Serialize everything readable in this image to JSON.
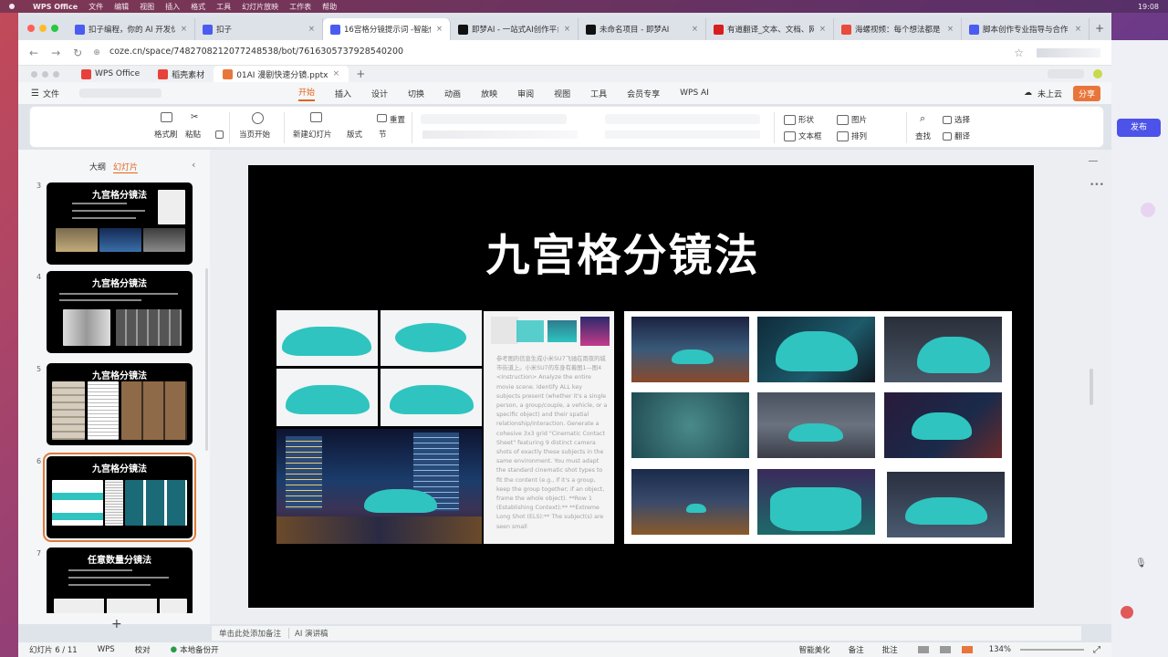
{
  "mac": {
    "app": "WPS Office",
    "menu": [
      "文件",
      "编辑",
      "视图",
      "插入",
      "格式",
      "工具",
      "幻灯片放映",
      "工作表",
      "帮助"
    ],
    "time": "19:08"
  },
  "browser": {
    "tabs": [
      {
        "label": "扣子编程，你的 AI 开发伙伴",
        "color": "#4a5cf0",
        "icon": "coze-icon"
      },
      {
        "label": "扣子",
        "color": "#4a5cf0",
        "icon": "coze-icon"
      },
      {
        "label": "16宫格分镜提示词 -智能体",
        "color": "#4a5cf0",
        "icon": "coze-icon",
        "active": true
      },
      {
        "label": "即梦AI - 一站式AI创作平台",
        "color": "#111",
        "icon": "jimeng-icon"
      },
      {
        "label": "未命名项目 - 即梦AI",
        "color": "#111",
        "icon": "jimeng-icon"
      },
      {
        "label": "有道翻译_文本、文档、网页",
        "color": "#d81e1e",
        "icon": "youdao-icon"
      },
      {
        "label": "海螺视频：每个想法都是",
        "color": "#e84a3c",
        "icon": "hailuo-icon"
      },
      {
        "label": "脚本创作专业指导与合作",
        "color": "#4a5cf0",
        "icon": "coze-icon"
      }
    ],
    "url": "coze.cn/space/7482708212077248538/bot/7616305737928540200"
  },
  "wps": {
    "tabs": [
      {
        "label": "WPS Office"
      },
      {
        "label": "稻壳素材"
      },
      {
        "label": "01AI 漫剧快速分镜.pptx",
        "active": true
      }
    ],
    "menu_file": "文件",
    "menu": [
      "开始",
      "插入",
      "设计",
      "切换",
      "动画",
      "放映",
      "审阅",
      "视图",
      "工具",
      "会员专享",
      "WPS AI"
    ],
    "cloud": "未上云",
    "share": "分享",
    "ribbon": {
      "format_painter": "格式刷",
      "paste": "粘贴",
      "from_current": "当页开始",
      "new_slide": "新建幻灯片",
      "layout": "版式",
      "section": "节",
      "reset": "重置",
      "shape": "形状",
      "picture": "图片",
      "textbox": "文本框",
      "arrange": "排列",
      "find": "查找",
      "select": "选择",
      "translate": "翻译"
    },
    "panel_tabs": {
      "outline": "大纲",
      "slides": "幻灯片"
    },
    "slides": [
      {
        "num": "3",
        "title": "九宫格分镜法"
      },
      {
        "num": "4",
        "title": "九宫格分镜法"
      },
      {
        "num": "5",
        "title": "九宫格分镜法"
      },
      {
        "num": "6",
        "title": "九宫格分镜法"
      },
      {
        "num": "7",
        "title": "任意数量分镜法"
      }
    ],
    "current_slide": {
      "title": "九宫格分镜法",
      "prompt": "参考图的信息生成小米SU7飞驰在雨夜的城市街道上。小米SU7的车身有着图1—图4 <Instruction> Analyze the entire movie scene. Identify ALL key subjects present (whether it's a single person, a group/couple, a vehicle, or a specific object) and their spatial relationship/interaction. Generate a cohesive 3x3 grid \"Cinematic Contact Sheet\" featuring 9 distinct camera shots of exactly these subjects in the same environment. You must adapt the standard cinematic shot types to fit the content (e.g., if it's a group, keep the group together; if an object, frame the whole object). **Row 1 (Establishing Context):** **Extreme Long Shot (ELS):** The subject(s) are seen small"
    },
    "xiaomi_logo": "xiaomi",
    "notes": "单击此处添加备注",
    "ai_notes": "AI 演讲稿",
    "status": {
      "slide_pos": "幻灯片 6 / 11",
      "wps": "WPS",
      "proof": "校对",
      "backup": "本地备份开",
      "beautify": "智能美化",
      "notes": "备注",
      "comment": "批注",
      "zoom": "134%"
    },
    "publish": "发布"
  }
}
